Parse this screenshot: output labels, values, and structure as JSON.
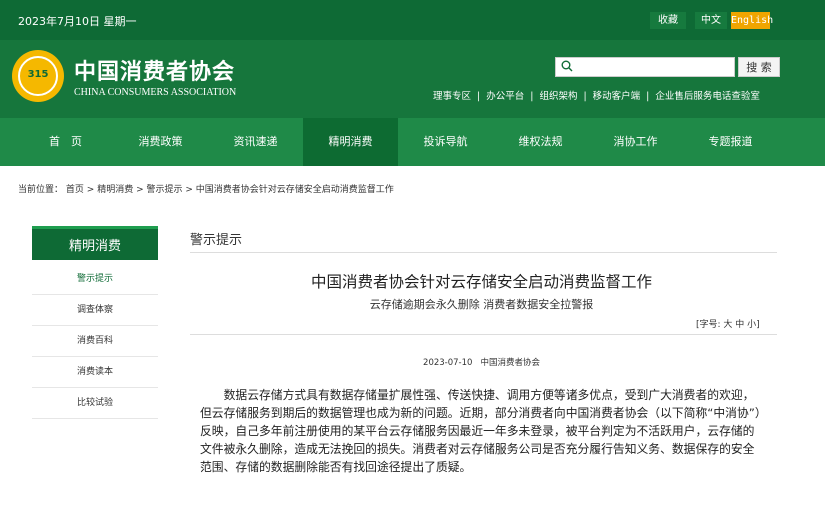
{
  "topbar": {
    "date": "2023年7月10日  星期一",
    "favorite": "收藏",
    "chinese": "中文",
    "english": "English"
  },
  "header": {
    "logo_text": "315",
    "title": "中国消费者协会",
    "subtitle": "CHINA CONSUMERS ASSOCIATION",
    "search_button": "搜 索",
    "search_value": "",
    "links": [
      "理事专区",
      "办公平台",
      "组织架构",
      "移动客户端",
      "企业售后服务电话查验室"
    ]
  },
  "nav": [
    "首　页",
    "消费政策",
    "资讯速递",
    "精明消费",
    "投诉导航",
    "维权法规",
    "消协工作",
    "专题报道"
  ],
  "breadcrumb": {
    "label": "当前位置：",
    "items": [
      "首页",
      "精明消费",
      "警示提示",
      "中国消费者协会针对云存储安全启动消费监督工作"
    ]
  },
  "sidebar": {
    "title": "精明消费",
    "items": [
      "警示提示",
      "调查体察",
      "消费百科",
      "消费读本",
      "比较试验"
    ]
  },
  "article": {
    "section": "警示提示",
    "title": "中国消费者协会针对云存储安全启动消费监督工作",
    "subtitle": "云存储逾期会永久删除 消费者数据安全拉警报",
    "font_size_label": "[字号: 大 中 小]",
    "date": "2023-07-10",
    "source": "中国消费者协会",
    "body": "数据云存储方式具有数据存储量扩展性强、传送快捷、调用方便等诸多优点，受到广大消费者的欢迎，但云存储服务到期后的数据管理也成为新的问题。近期，部分消费者向中国消费者协会（以下简称“中消协”）反映，自己多年前注册使用的某平台云存储服务因最近一年多未登录，被平台判定为不活跃用户，云存储的文件被永久删除，造成无法挽回的损失。消费者对云存储服务公司是否充分履行告知义务、数据保存的安全范围、存储的数据删除能否有找回途径提出了质疑。"
  },
  "colors": {
    "dark_green": "#0e6a35",
    "nav_green": "#1f8a48",
    "header_green": "#16763c",
    "english_orange": "#f0a500",
    "logo_yellow": "#f5b800"
  }
}
